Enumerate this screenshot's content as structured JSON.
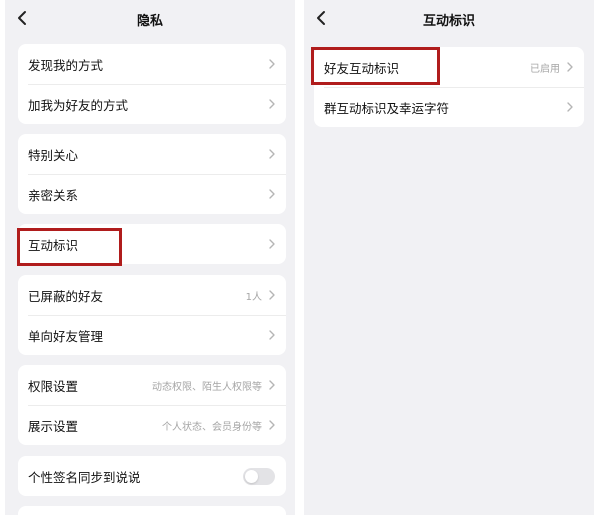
{
  "colors": {
    "highlight": "#b01c1c",
    "background": "#f1f1f4",
    "card": "#ffffff"
  },
  "left": {
    "title": "隐私",
    "groups": [
      {
        "items": [
          {
            "label": "发现我的方式"
          },
          {
            "label": "加我为好友的方式"
          }
        ]
      },
      {
        "items": [
          {
            "label": "特别关心"
          },
          {
            "label": "亲密关系"
          }
        ]
      },
      {
        "items": [
          {
            "label": "互动标识"
          }
        ]
      },
      {
        "items": [
          {
            "label": "已屏蔽的好友",
            "value": "1人"
          },
          {
            "label": "单向好友管理"
          }
        ]
      },
      {
        "items": [
          {
            "label": "权限设置",
            "value": "动态权限、陌生人权限等"
          },
          {
            "label": "展示设置",
            "value": "个人状态、会员身份等"
          }
        ]
      },
      {
        "items": [
          {
            "label": "个性签名同步到说说",
            "toggle": "off"
          }
        ]
      }
    ]
  },
  "right": {
    "title": "互动标识",
    "items": [
      {
        "label": "好友互动标识",
        "value": "已启用"
      },
      {
        "label": "群互动标识及幸运字符"
      }
    ]
  }
}
